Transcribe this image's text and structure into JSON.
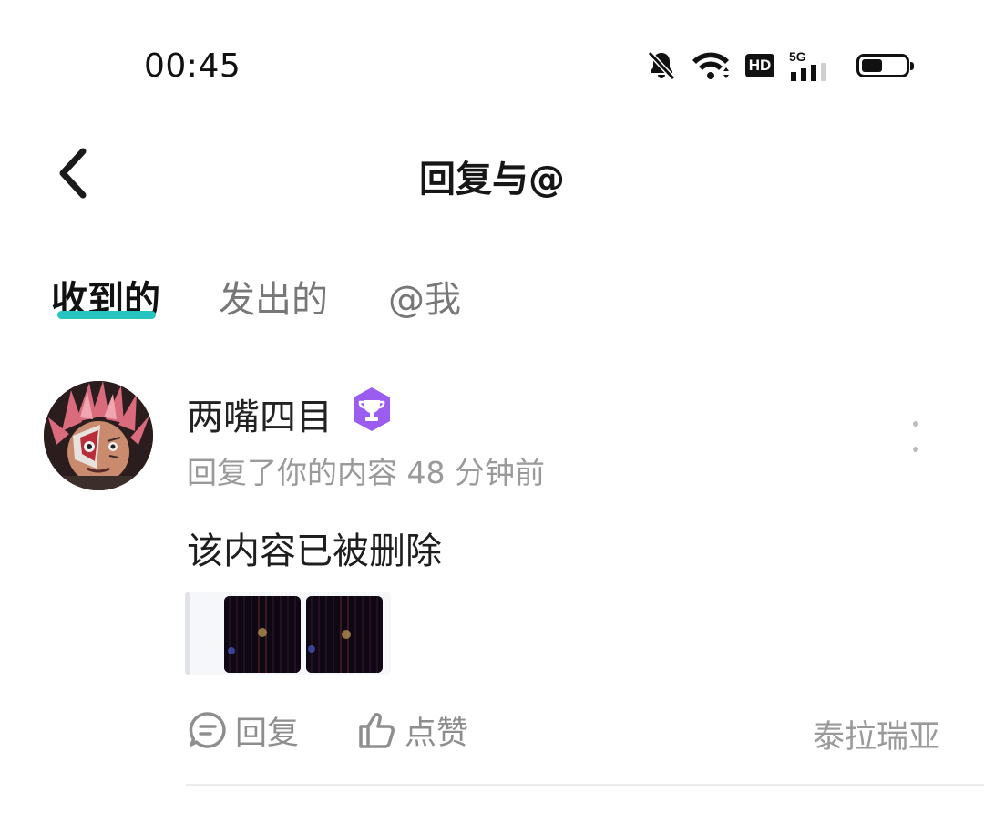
{
  "status_bar": {
    "time": "00:45",
    "hd_label": "HD",
    "network_label": "5G"
  },
  "header": {
    "title": "回复与@"
  },
  "tabs": [
    {
      "label": "收到的",
      "active": true
    },
    {
      "label": "发出的",
      "active": false
    },
    {
      "label": "@我",
      "active": false
    }
  ],
  "comment": {
    "username": "两嘴四目",
    "meta": "回复了你的内容 48 分钟前",
    "content": "该内容已被删除",
    "actions": {
      "reply_label": "回复",
      "like_label": "点赞"
    },
    "tag": "泰拉瑞亚"
  },
  "colors": {
    "accent": "#27c4c0",
    "badge": "#9b5cf0",
    "muted_text": "#9a9a9a"
  }
}
